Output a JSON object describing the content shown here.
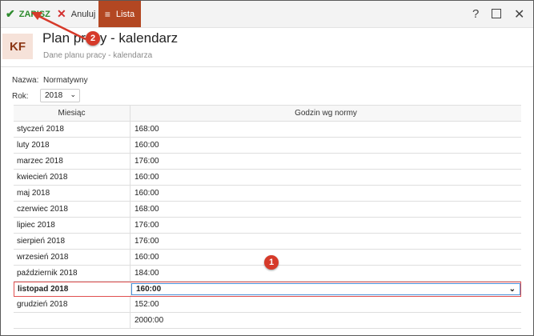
{
  "toolbar": {
    "save_label": "ZAPISZ",
    "cancel_label": "Anuluj",
    "list_label": "Lista",
    "help": "?"
  },
  "header": {
    "badge": "KF",
    "title": "Plan pracy - kalendarz",
    "subtitle": "Dane planu pracy - kalendarza"
  },
  "form": {
    "nazwa_label": "Nazwa:",
    "nazwa_value": "Normatywny",
    "rok_label": "Rok:",
    "rok_value": "2018"
  },
  "grid": {
    "columns": [
      "Miesiąc",
      "Godzin wg normy"
    ],
    "rows": [
      {
        "month": "styczeń 2018",
        "hours": "168:00"
      },
      {
        "month": "luty 2018",
        "hours": "160:00"
      },
      {
        "month": "marzec 2018",
        "hours": "176:00"
      },
      {
        "month": "kwiecień 2018",
        "hours": "160:00"
      },
      {
        "month": "maj 2018",
        "hours": "160:00"
      },
      {
        "month": "czerwiec 2018",
        "hours": "168:00"
      },
      {
        "month": "lipiec 2018",
        "hours": "176:00"
      },
      {
        "month": "sierpień 2018",
        "hours": "176:00"
      },
      {
        "month": "wrzesień 2018",
        "hours": "160:00"
      },
      {
        "month": "październik 2018",
        "hours": "184:00"
      },
      {
        "month": "listopad 2018",
        "hours": "160:00"
      },
      {
        "month": "grudzień 2018",
        "hours": "152:00"
      }
    ],
    "total": "2000:00"
  },
  "markers": {
    "m1": "1",
    "m2": "2"
  },
  "colors": {
    "accent": "#b34722",
    "save": "#2e8b2e",
    "cancel": "#d32f2f",
    "marker": "#d63a2a"
  }
}
